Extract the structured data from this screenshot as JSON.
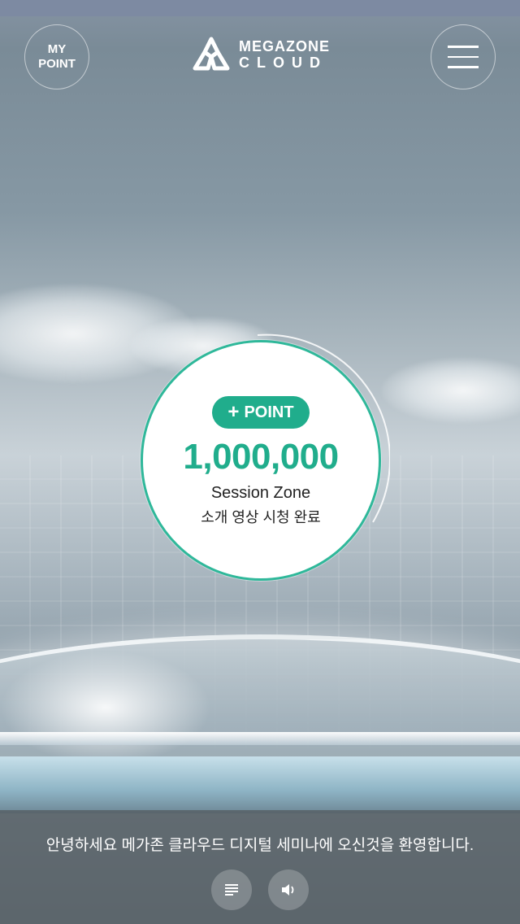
{
  "header": {
    "my_point_line1": "MY",
    "my_point_line2": "POINT",
    "logo_line1": "MEGAZONE",
    "logo_line2": "CLOUD",
    "menu_icon": "hamburger-menu-icon"
  },
  "point_card": {
    "badge_label": "POINT",
    "badge_icon": "plus-icon",
    "value": "1,000,000",
    "line1": "Session Zone",
    "line2": "소개 영상 시청 완료"
  },
  "footer": {
    "message": "안녕하세요 메가존 클라우드 디지털 세미나에 오신것을 환영합니다.",
    "controls": [
      "text-align-icon",
      "speaker-icon"
    ]
  },
  "colors": {
    "accent": "#20ad8c",
    "ring": "#2fb89a"
  }
}
